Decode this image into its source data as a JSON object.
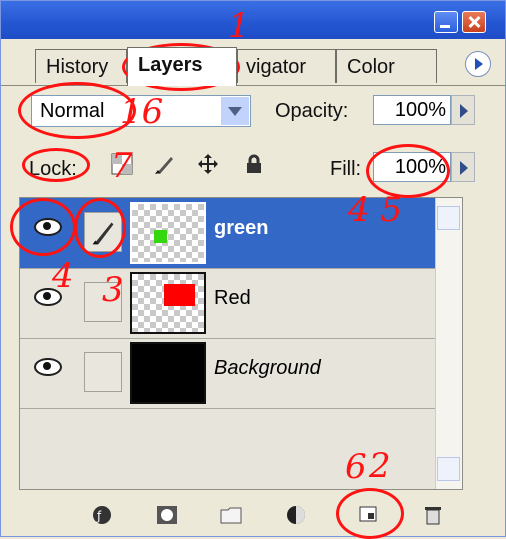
{
  "tabs": [
    "History",
    "Layers",
    "vigator",
    "Color"
  ],
  "blend_mode": "Normal",
  "opacity_label": "Opacity:",
  "opacity_value": "100%",
  "lock_label": "Lock:",
  "fill_label": "Fill:",
  "fill_value": "100%",
  "layers": [
    {
      "name": "green",
      "selected": true
    },
    {
      "name": "Red",
      "selected": false
    },
    {
      "name": "Background",
      "selected": false
    }
  ],
  "annotations": [
    "1",
    "16",
    "7",
    "4 5",
    "3",
    "4",
    "2",
    "6"
  ],
  "colors": {
    "selection": "#3468c6",
    "accent": "#2456d1",
    "annotation": "#ff1212",
    "green": "#35d80f",
    "red": "#ff0000"
  }
}
